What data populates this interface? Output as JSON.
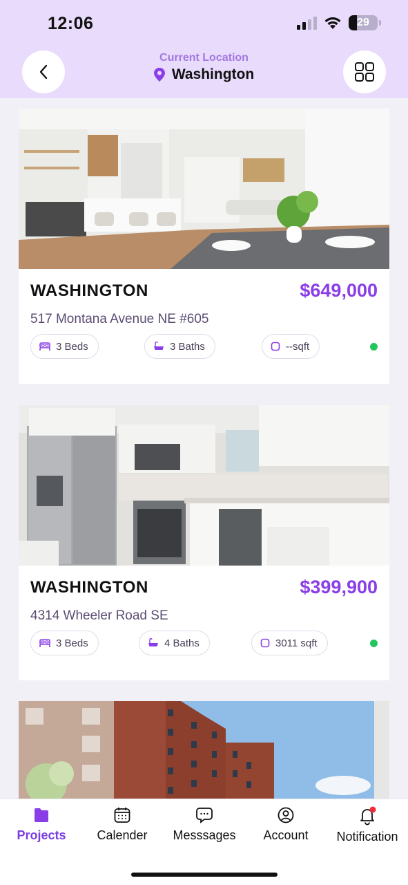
{
  "status_bar": {
    "time": "12:06",
    "battery": "29"
  },
  "header": {
    "location_label": "Current Location",
    "location_value": "Washington"
  },
  "listings": [
    {
      "city": "WASHINGTON",
      "price": "$649,000",
      "address": "517 Montana Avenue NE #605",
      "beds": "3 Beds",
      "baths": "3 Baths",
      "area": "--sqft",
      "status_color": "#22c55e"
    },
    {
      "city": "WASHINGTON",
      "price": "$399,900",
      "address": "4314 Wheeler Road SE",
      "beds": "3 Beds",
      "baths": "4 Baths",
      "area": "3011 sqft",
      "status_color": "#22c55e"
    }
  ],
  "tabs": [
    {
      "label": "Projects",
      "icon": "folder-icon",
      "active": true
    },
    {
      "label": "Calender",
      "icon": "calendar-icon",
      "active": false
    },
    {
      "label": "Messsages",
      "icon": "chat-icon",
      "active": false
    },
    {
      "label": "Account",
      "icon": "user-icon",
      "active": false
    },
    {
      "label": "Notification",
      "icon": "bell-icon",
      "active": false
    }
  ],
  "colors": {
    "accent": "#8a3ee8",
    "header_bg": "#e8dbfb",
    "status_online": "#22c55e"
  }
}
